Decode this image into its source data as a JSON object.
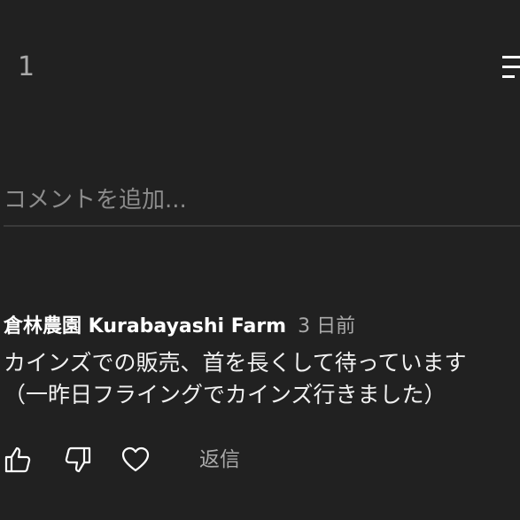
{
  "header": {
    "comment_count": "1"
  },
  "input": {
    "placeholder": "コメントを追加..."
  },
  "comment": {
    "author": "倉林農園 Kurabayashi Farm",
    "timestamp": "3 日前",
    "text": "カインズでの販売、首を長くして待っています\n（一昨日フライングでカインズ行きました）"
  },
  "actions": {
    "reply_label": "返信",
    "icons": [
      "thumbs-up-icon",
      "thumbs-down-icon",
      "heart-icon"
    ]
  },
  "colors": {
    "background": "#212121",
    "primary_text": "#ffffff",
    "secondary_text": "#aaaaaa",
    "divider": "#3a3a3a"
  }
}
